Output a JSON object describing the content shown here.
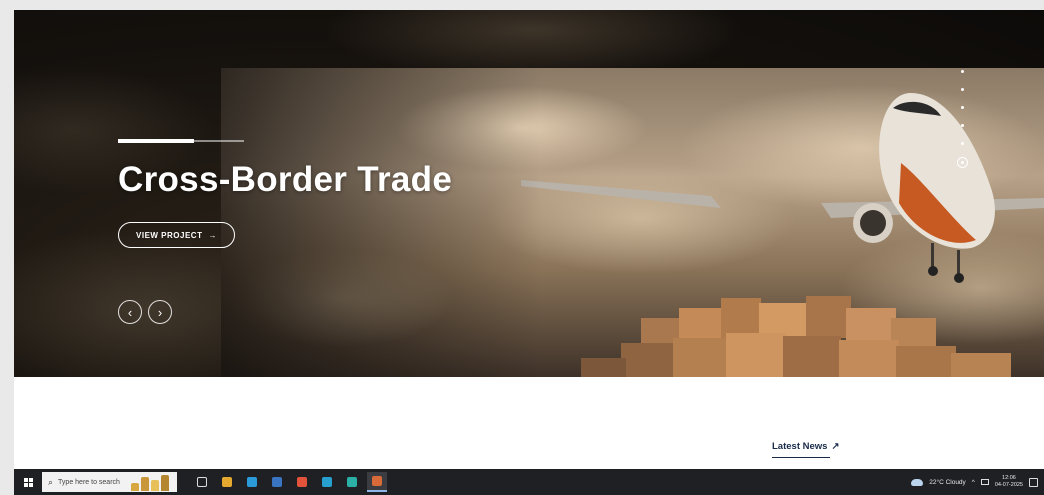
{
  "hero": {
    "title": "Cross-Border Trade",
    "cta_label": "VIEW PROJECT",
    "cta_arrow": "→",
    "prev_glyph": "‹",
    "next_glyph": "›",
    "slide_dots": 5,
    "active_dot_index": 5
  },
  "section": {
    "latest_news_label": "Latest News",
    "latest_news_arrow": "↗"
  },
  "taskbar": {
    "search_placeholder": "Type here to search",
    "search_glyph": "⌕",
    "weather": "22°C  Cloudy",
    "time": "12:06",
    "date": "04-07-2025",
    "tray_chevron": "^",
    "icon_colors": [
      "#2f77d1",
      "#e5a92f",
      "#2a9bd8",
      "#3a75c4",
      "#e2533b",
      "#27a0d0",
      "#2ab0a6",
      "#d86a3a"
    ],
    "icon_names": [
      "task-view-icon",
      "edge-browser-icon",
      "file-explorer-icon",
      "mail-icon",
      "chrome-icon",
      "edge-icon",
      "app-icon",
      "app-active-icon"
    ]
  },
  "colors": {
    "accent_text": "#1a2b4a",
    "taskbar_bg": "#1f2024"
  }
}
